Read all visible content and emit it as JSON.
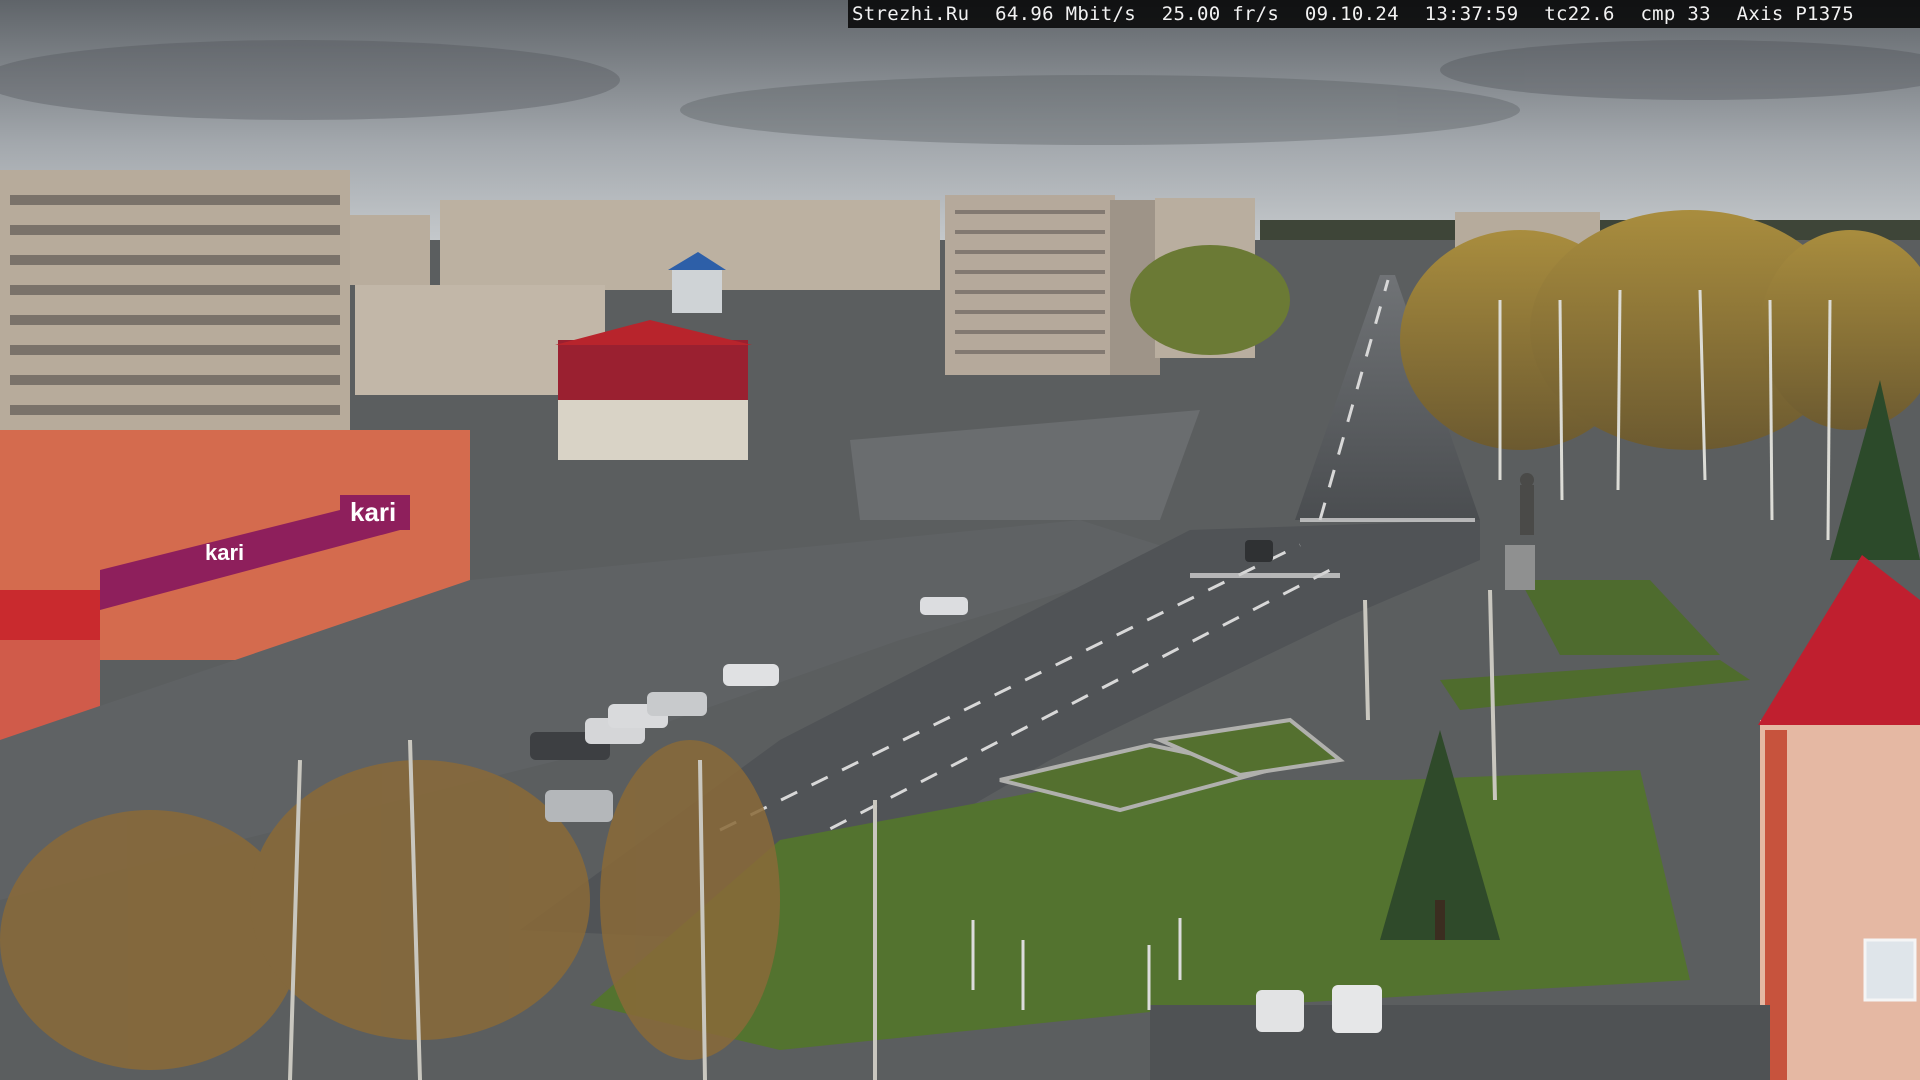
{
  "overlay": {
    "site": "Strezhi.Ru",
    "bitrate": "64.96 Mbit/s",
    "framerate": "25.00 fr/s",
    "date": "09.10.24",
    "time": "13:37:59",
    "tc": "tc22.6",
    "cmp": "cmp 33",
    "camera_model": "Axis P1375"
  },
  "store_signs": {
    "kari_main": "kari",
    "kari_side": "kari"
  },
  "colors": {
    "sky_top": "#6f7479",
    "sky_bottom": "#b9bec2",
    "asphalt": "#55585a",
    "grass": "#4e6b2e",
    "brand_kari": "#8e1f5c",
    "roof_red": "#b8242c"
  }
}
